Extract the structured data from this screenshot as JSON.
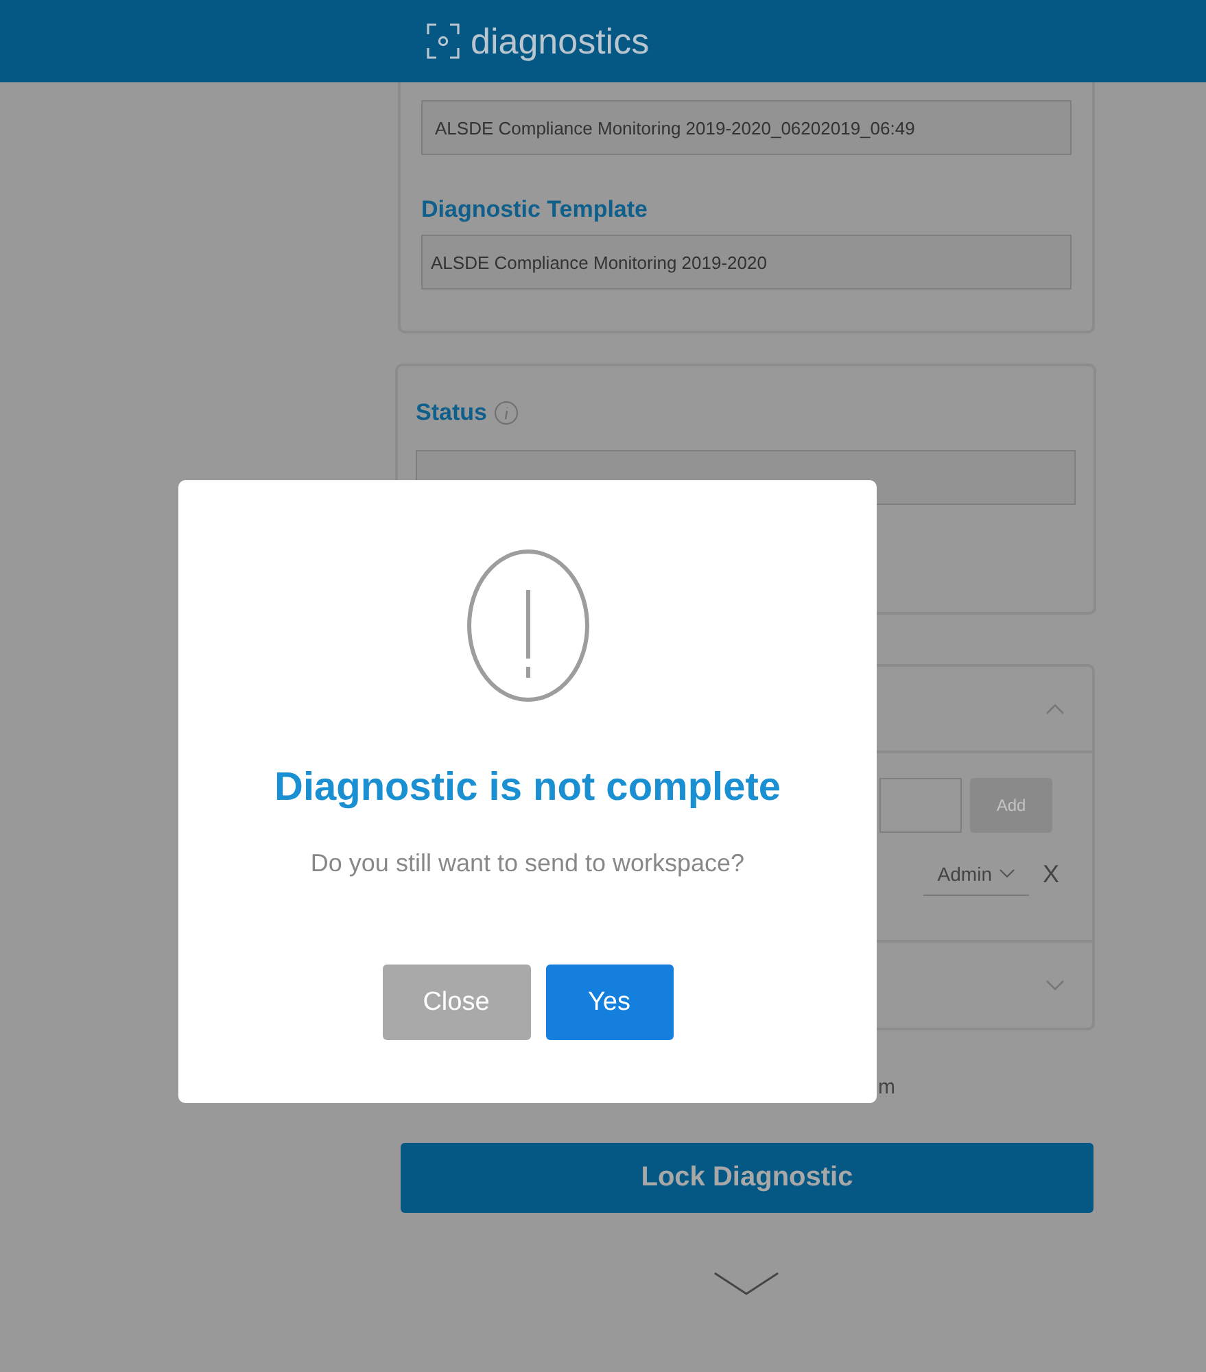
{
  "header": {
    "title": "diagnostics"
  },
  "details_card": {
    "name_value": "ALSDE Compliance Monitoring 2019-2020_06202019_06:49",
    "template_label": "Diagnostic Template",
    "template_value": "ALSDE Compliance Monitoring 2019-2020"
  },
  "status_card": {
    "label": "Status"
  },
  "sharing_card": {
    "expanded": true,
    "add_button": "Add",
    "role": "Admin",
    "remove": "X"
  },
  "partial_text": "m",
  "lock_button": "Lock Diagnostic",
  "dialog": {
    "title": "Diagnostic is not complete",
    "message": "Do you still want to send to workspace?",
    "buttons": [
      {
        "label": "Close",
        "kind": "secondary"
      },
      {
        "label": "Yes",
        "kind": "primary"
      }
    ]
  }
}
